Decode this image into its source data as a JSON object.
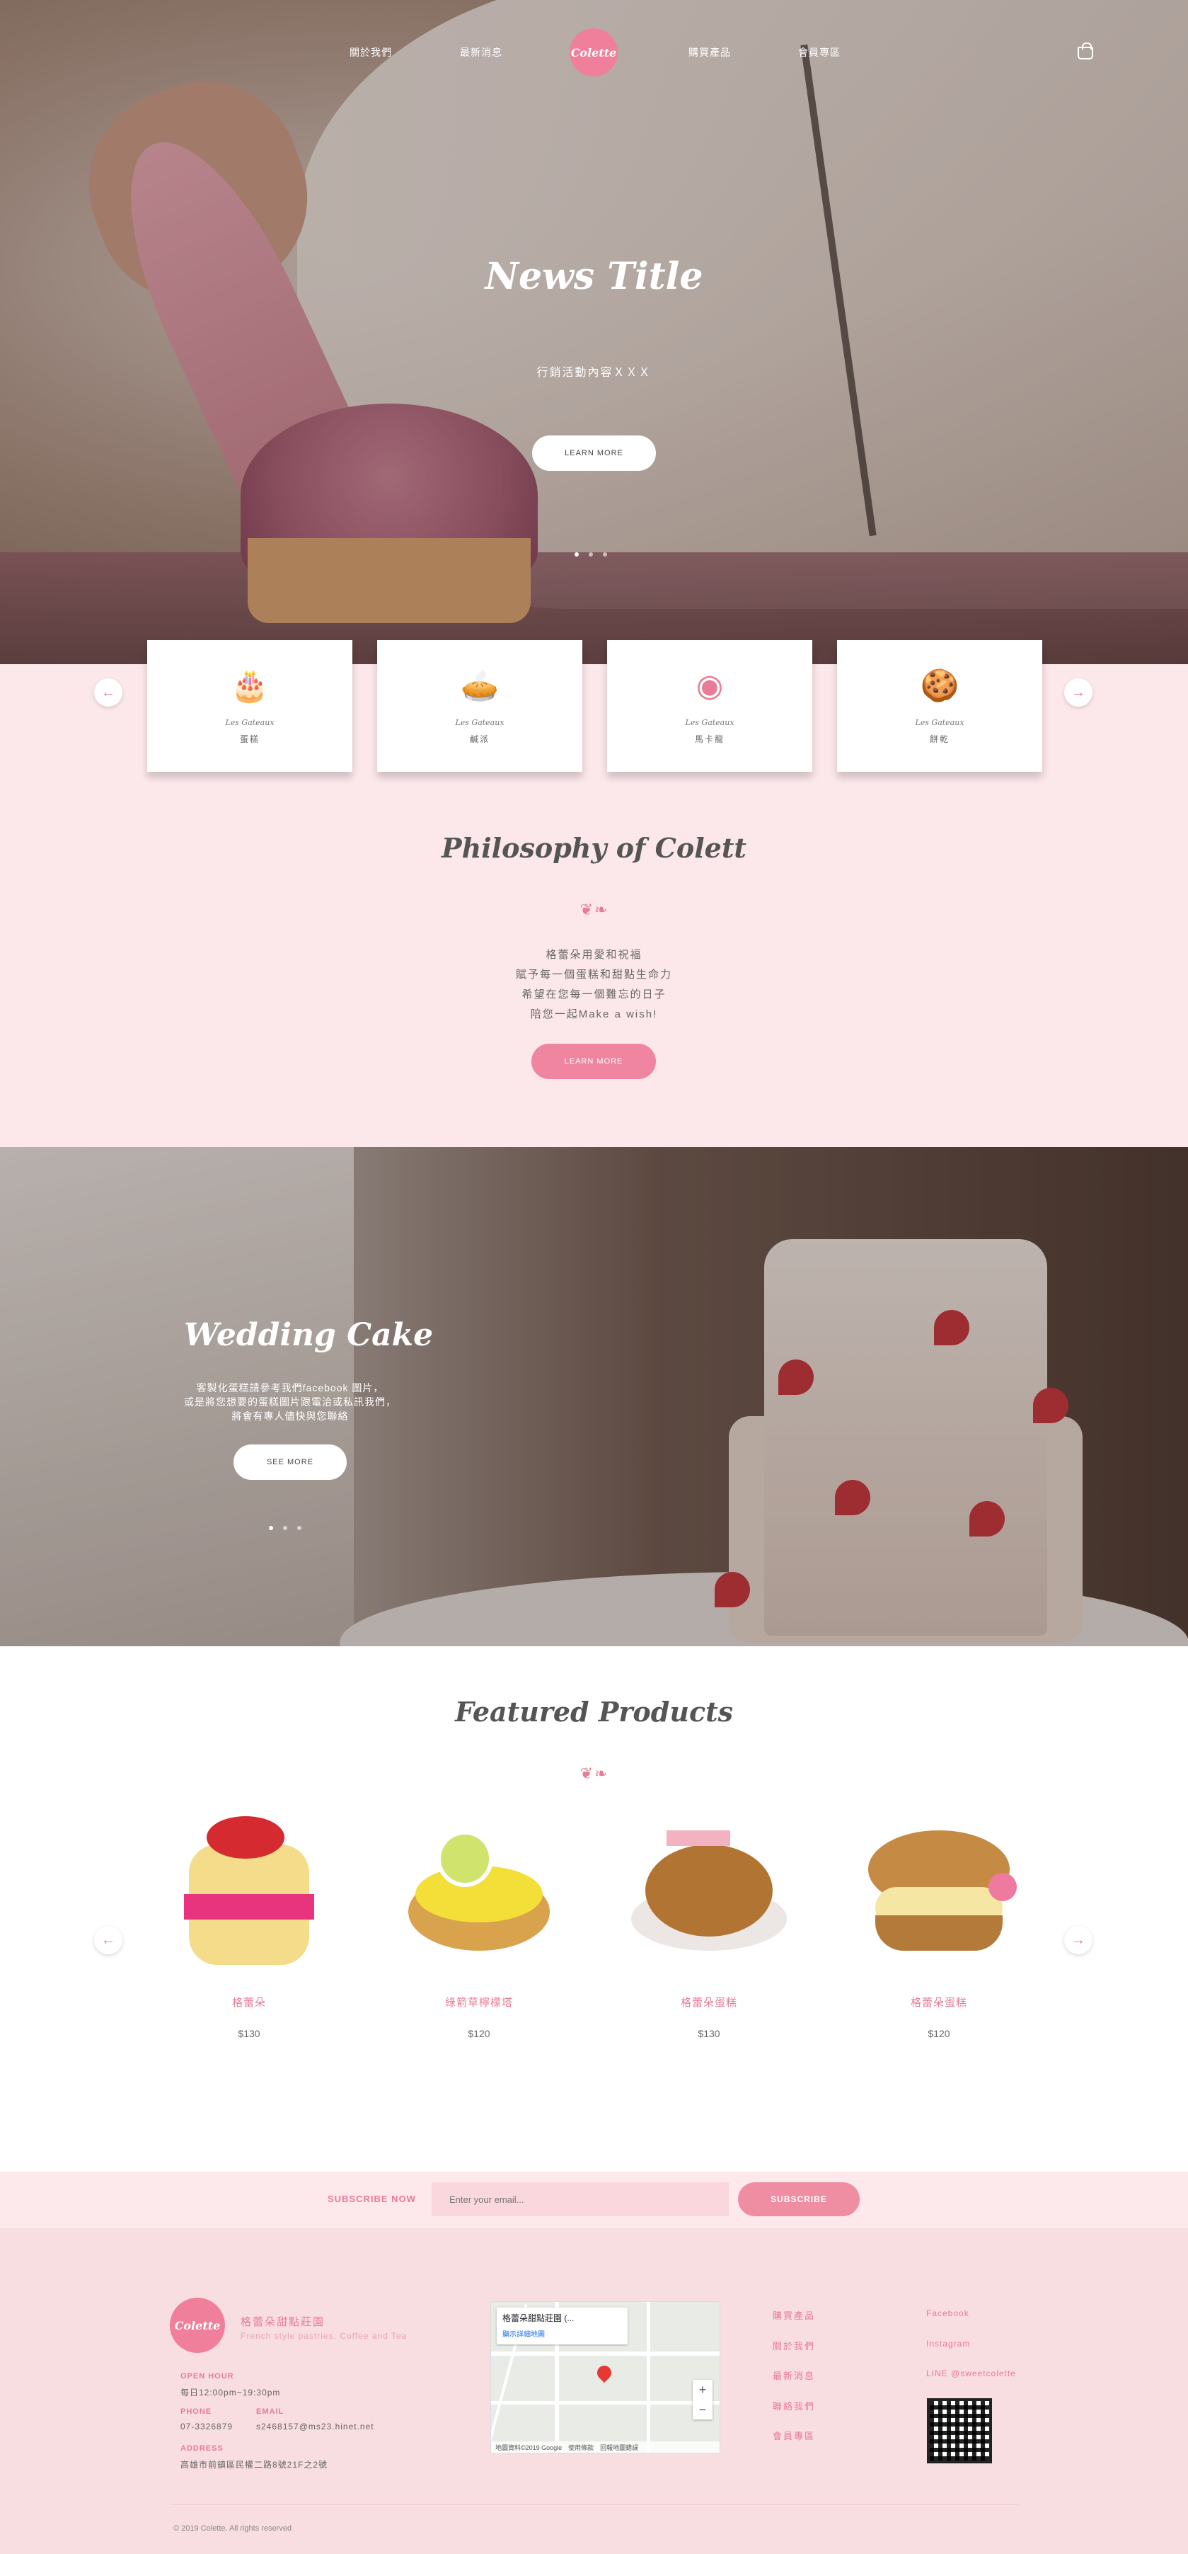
{
  "nav": {
    "items": [
      "關於我們",
      "最新消息",
      "購買產品",
      "會員專區"
    ],
    "logo": "Colette"
  },
  "hero": {
    "title": "News Title",
    "subtitle": "行銷活動內容ＸＸＸ",
    "button": "LEARN MORE",
    "slides": 3,
    "active_slide": 1
  },
  "categories": [
    {
      "icon": "cake-icon",
      "glyph": "🎂",
      "en": "Les Gateaux",
      "zh": "蛋糕"
    },
    {
      "icon": "pie-icon",
      "glyph": "🥧",
      "en": "Les Gateaux",
      "zh": "鹹派"
    },
    {
      "icon": "macaron-icon",
      "glyph": "◉",
      "en": "Les Gateaux",
      "zh": "馬卡龍"
    },
    {
      "icon": "cookie-icon",
      "glyph": "🍪",
      "en": "Les Gateaux",
      "zh": "餅乾"
    }
  ],
  "philosophy": {
    "title": "Philosophy of Colett",
    "lines": [
      "格蕾朵用愛和祝福",
      "賦予每一個蛋糕和甜點生命力",
      "希望在您每一個難忘的日子",
      "陪您一起Make a wish!"
    ],
    "button": "LEARN MORE"
  },
  "wedding": {
    "title": "Wedding Cake",
    "text": [
      "客製化蛋糕請參考我們facebook 圖片，",
      "或是將您想要的蛋糕圖片跟電洽或私訊我們，",
      "將會有專人儘快與您聯絡"
    ],
    "button": "SEE MORE",
    "slides": 3,
    "active_slide": 1
  },
  "featured": {
    "title": "Featured Products",
    "products": [
      {
        "name": "格蕾朵",
        "price": "$130"
      },
      {
        "name": "綠箭草檸檬塔",
        "price": "$120"
      },
      {
        "name": "格蕾朵蛋糕",
        "price": "$130"
      },
      {
        "name": "格蕾朵蛋糕",
        "price": "$120"
      }
    ]
  },
  "subscribe": {
    "label": "SUBSCRIBE NOW",
    "placeholder": "Enter your email...",
    "button": "SUBSCRIBE"
  },
  "footer": {
    "name": "格蕾朵甜點莊園",
    "tagline": "French style pastries, Coffee and Tea",
    "open_label": "OPEN HOUR",
    "open_value": "每日12:00pm~19:30pm",
    "phone_label": "PHONE",
    "phone_value": "07-3326879",
    "email_label": "EMAIL",
    "email_value": "s2468157@ms23.hinet.net",
    "address_label": "ADDRESS",
    "address_value": "高雄市前鎮區民權二路8號21F之2號",
    "map_title": "格蕾朵甜點莊園 (...",
    "map_link": "顯示詳細地圖",
    "map_credit": "地圖資料©2019 Google　使用條款　回報地圖錯誤",
    "links": [
      "購買產品",
      "關於我們",
      "最新消息",
      "聯絡我們",
      "會員專區"
    ],
    "social": [
      "Facebook",
      "Instagram",
      "LINE @sweetcolette"
    ],
    "copyright": "© 2019 Colette. All rights reserved"
  },
  "colors": {
    "accent": "#ef85a0",
    "bg_pink": "#fce7ea",
    "footer_pink": "#f8dde1"
  }
}
